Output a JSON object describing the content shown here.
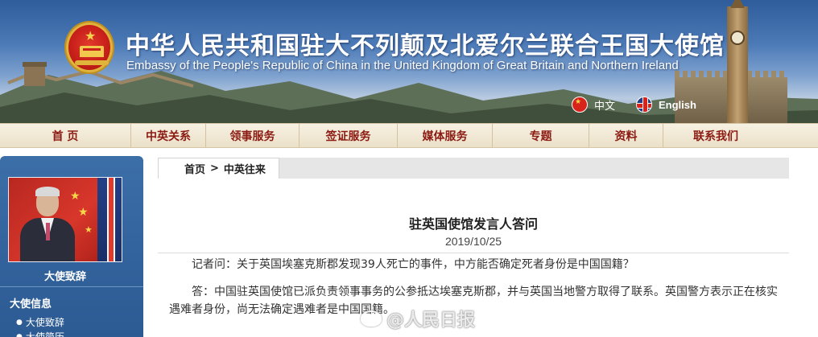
{
  "header": {
    "title_cn": "中华人民共和国驻大不列颠及北爱尔兰联合王国大使馆",
    "title_en": "Embassy of the People's Republic of China in the United Kingdom of Great Britain and Northern Ireland",
    "lang_cn": "中文",
    "lang_en": "English"
  },
  "nav": {
    "items": [
      "首 页",
      "中英关系",
      "领事服务",
      "签证服务",
      "媒体服务",
      "专题",
      "资料",
      "联系我们"
    ]
  },
  "sidebar": {
    "caption": "大使致辞",
    "heading": "大使信息",
    "links": [
      "大使致辞",
      "大使简历"
    ]
  },
  "breadcrumb": {
    "home": "首页",
    "separator": ">",
    "current": "中英往来"
  },
  "article": {
    "title": "驻英国使馆发言人答问",
    "date": "2019/10/25",
    "question": "记者问：关于英国埃塞克斯郡发现39人死亡的事件，中方能否确定死者身份是中国国籍？",
    "answer_line1": "答：中国驻英国使馆已派负责领事事务的公参抵达埃塞克斯郡，并与英国当地警方取得了联系。英国警方表示正在核实",
    "answer_line2": "遇难者身份，尚无法确定遇难者是中国国籍。"
  },
  "watermark": {
    "text": "@人民日报"
  },
  "colors": {
    "banner_blue": "#2f5c9a",
    "nav_text": "#8b1a12",
    "sidebar_blue": "#3c6ea8"
  }
}
